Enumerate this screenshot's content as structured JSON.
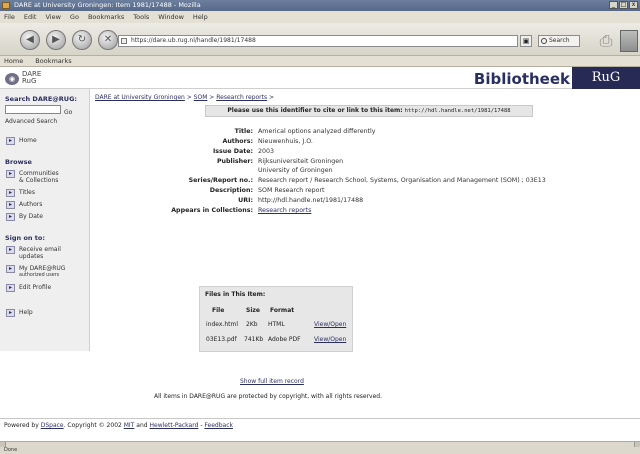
{
  "window": {
    "title": "DARE at University Groningen: Item 1981/17488 - Mozilla",
    "controls": [
      "_",
      "□",
      "x"
    ]
  },
  "menu": [
    "File",
    "Edit",
    "View",
    "Go",
    "Bookmarks",
    "Tools",
    "Window",
    "Help"
  ],
  "nav": {
    "url": "https://dare.ub.rug.nl/handle/1981/17488",
    "search_label": "Search"
  },
  "bookmarks": [
    "Home",
    "Bookmarks"
  ],
  "banner": {
    "logo_text_1": "DARE",
    "logo_text_2": "RuG",
    "library": "Bibliotheek",
    "brand": "RuG"
  },
  "sidebar": {
    "search_title": "Search DARE@RUG:",
    "go_label": "Go",
    "advanced": "Advanced Search",
    "home": "Home",
    "browse_title": "Browse",
    "browse_items": [
      {
        "label": "Communities",
        "label2": "& Collections"
      },
      {
        "label": "Titles"
      },
      {
        "label": "Authors"
      },
      {
        "label": "By Date"
      }
    ],
    "signon_title": "Sign on to:",
    "signon_items": [
      {
        "label": "Receive email",
        "label2": "updates"
      },
      {
        "label": "My DARE@RUG",
        "label2": "authorized users"
      },
      {
        "label": "Edit Profile"
      }
    ],
    "help": "Help"
  },
  "breadcrumb": {
    "items": [
      "DARE at University Groningen",
      "SOM",
      "Research reports"
    ],
    "sep": " > "
  },
  "identifier": {
    "text": "Please use this identifier to cite or link to this item:",
    "uri": "http://hdl.handle.net/1981/17488"
  },
  "meta": [
    {
      "label": "Title:",
      "value": "Americal options analyzed differently"
    },
    {
      "label": "Authors:",
      "value": "Nieuwenhuis, J.O."
    },
    {
      "label": "Issue Date:",
      "value": "2003"
    },
    {
      "label": "Publisher:",
      "value": "Rijksuniversiteit Groningen",
      "value2": "University of Groningen"
    },
    {
      "label": "Series/Report no.:",
      "value": "Research report / Research School, Systems, Organisation and Management (SOM) ; 03E13"
    },
    {
      "label": "Description:",
      "value": "SOM Research report"
    },
    {
      "label": "URI:",
      "value": "http://hdl.handle.net/1981/17488"
    },
    {
      "label": "Appears in Collections:",
      "value": "Research reports",
      "link": true
    }
  ],
  "files": {
    "title": "Files in This Item:",
    "headers": [
      "File",
      "Size",
      "Format",
      ""
    ],
    "rows": [
      [
        "index.html",
        "2Kb",
        "HTML",
        "View/Open"
      ],
      [
        "03E13.pdf",
        "741Kb",
        "Adobe PDF",
        "View/Open"
      ]
    ]
  },
  "full_record": "Show full item record",
  "rights": "All items in DARE@RUG are protected by copyright, with all rights reserved.",
  "footer": {
    "prefix": "Powered by",
    "dspace": "DSpace",
    "mid": ". Copyright © 2002",
    "mit": "MIT",
    "and": "and",
    "hp": "Hewlett-Packard",
    "dash": " - ",
    "feedback": "Feedback"
  },
  "status": "Done"
}
